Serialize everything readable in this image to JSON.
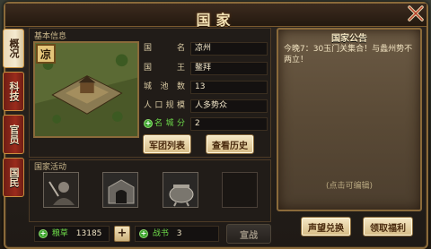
{
  "title": "国家",
  "tabs": [
    {
      "label": "概况",
      "active": true
    },
    {
      "label": "科技",
      "active": false
    },
    {
      "label": "官员",
      "active": false
    },
    {
      "label": "国民",
      "active": false
    }
  ],
  "basic_info": {
    "section_label": "基本信息",
    "nation_badge": "凉",
    "fields": [
      {
        "label": "国名",
        "value": "凉州",
        "green": false
      },
      {
        "label": "国王",
        "value": "鳌拜",
        "green": false
      },
      {
        "label": "城池数",
        "value": "13",
        "green": false
      },
      {
        "label": "人口规模",
        "value": "人多势众",
        "green": false
      },
      {
        "label": "名城分",
        "value": "2",
        "green": true
      }
    ],
    "buttons": {
      "legion_list": "军团列表",
      "view_history": "查看历史"
    }
  },
  "activities": {
    "section_label": "国家活动"
  },
  "resources": {
    "grain_label": "粮草",
    "grain_value": "13185",
    "add": "+",
    "warbook_label": "战书",
    "warbook_value": "3",
    "declare_war": "宣战"
  },
  "notice": {
    "title": "国家公告",
    "text": "今晚7：30玉门关集合！与蠡州势不两立！",
    "hint": "(点击可编辑)"
  },
  "actions": {
    "prestige_exchange": "声望兑换",
    "claim_benefits": "领取福利"
  },
  "icons": {
    "close": "close-x-icon",
    "plus": "green-plus-icon"
  },
  "colors": {
    "accent_gold": "#8a6a3a",
    "tab_red": "#9a2b1c",
    "green": "#6edc4a"
  }
}
